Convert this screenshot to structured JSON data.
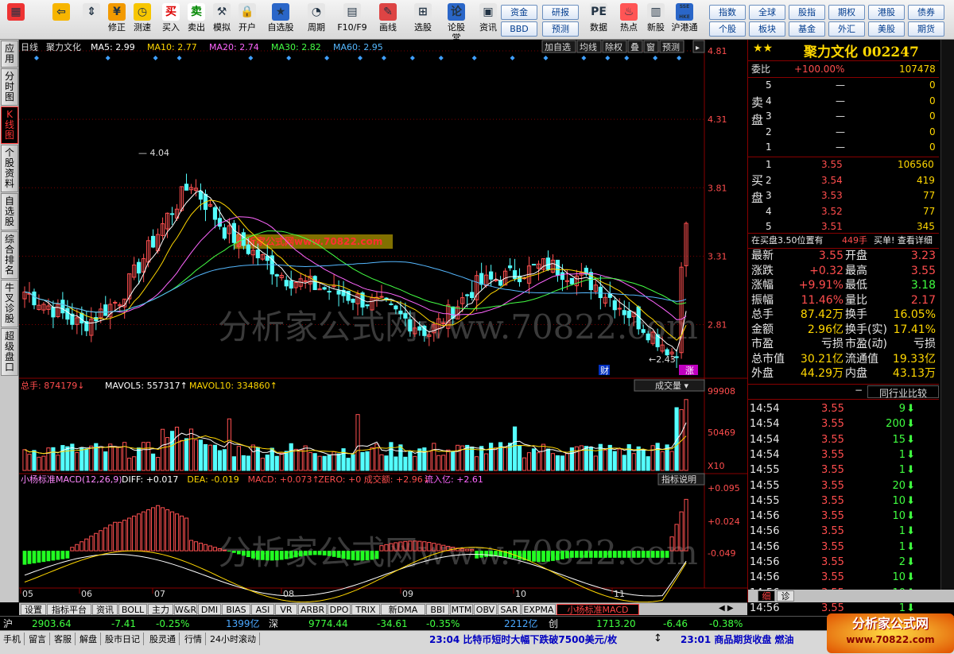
{
  "toolbar": {
    "buttons": [
      {
        "label": "",
        "icon": "grid-icon"
      },
      {
        "label": "",
        "icon": "back-arrow-icon"
      },
      {
        "label": "",
        "icon": "up-down-icon"
      },
      {
        "label": "修正",
        "icon": "money-icon"
      },
      {
        "label": "测速",
        "icon": "clock-icon"
      },
      {
        "label": "买入",
        "icon": "buy-icon"
      },
      {
        "label": "卖出",
        "icon": "sell-icon"
      },
      {
        "label": "模拟",
        "icon": "hammer-icon"
      },
      {
        "label": "开户",
        "icon": "lock-icon"
      },
      {
        "label": "自选股",
        "icon": "star-icon"
      },
      {
        "label": "周期",
        "icon": "clock-dial-icon"
      },
      {
        "label": "F10/F9",
        "icon": "info-icon"
      },
      {
        "label": "画线",
        "icon": "pencil-icon"
      },
      {
        "label": "选股",
        "icon": "filter-icon"
      },
      {
        "label": "论股堂",
        "icon": "discuss-icon"
      },
      {
        "label": "资讯",
        "icon": "news-icon"
      },
      {
        "label": "数据",
        "icon": "pe-icon"
      },
      {
        "label": "热点",
        "icon": "fire-icon"
      },
      {
        "label": "新股",
        "icon": "new-stock-icon"
      },
      {
        "label": "沪港通",
        "icon": "hk-icon"
      }
    ],
    "link_buttons": [
      "资金",
      "BBD",
      "研报",
      "预测",
      "指数",
      "个股",
      "全球",
      "板块",
      "股指",
      "基金",
      "期权",
      "外汇",
      "港股",
      "美股",
      "债券",
      "期货"
    ],
    "icon_texts": {
      "buy": "买",
      "sell": "卖",
      "discuss": "论",
      "pe": "PE",
      "hk": "SSE HKE"
    }
  },
  "sidetabs": [
    "应用",
    "分时图",
    "K线图",
    "个股资料",
    "自选股",
    "综合排名",
    "牛叉诊股",
    "超级盘口"
  ],
  "chart_header": {
    "period": "日线",
    "name": "聚力文化",
    "ma5": "MA5: 2.99",
    "ma10": "MA10: 2.77",
    "ma20": "MA20: 2.74",
    "ma30": "MA30: 2.82",
    "ma60": "MA60: 2.95"
  },
  "chart_buttons": [
    "加自选",
    "均线",
    "除权",
    "叠",
    "窗",
    "预测"
  ],
  "vol_header": {
    "total": "总手: 874179",
    "mavol5": "MAVOL5: 557317",
    "mavol10": "MAVOL10: 334860",
    "dropdown": "成交量"
  },
  "macd_header": {
    "name": "小杨标准MACD(12,26,9)",
    "diff": "DIFF: +0.017",
    "dea": "DEA: -0.019",
    "macd": "MACD: +0.073",
    "zero": "ZERO: +0",
    "amount": "成交额: +2.96",
    "inflow": "流入亿: +2.61",
    "help": "指标说明"
  },
  "watermark": {
    "main": "分析家公式网www.70822.com",
    "banner": "分析家公式网www.70822.com"
  },
  "axis_labels": {
    "price": [
      "4.81",
      "4.31",
      "3.81",
      "3.31",
      "2.81"
    ],
    "vol": [
      "99908",
      "50469",
      "X10"
    ],
    "macd": [
      "+0.095",
      "+0.024",
      "-0.049"
    ],
    "months": [
      "05",
      "06",
      "07",
      "08",
      "09",
      "10",
      "11"
    ]
  },
  "markers": {
    "hi": "4.04",
    "lo": "2.43",
    "fin": "财",
    "limit": "涨"
  },
  "chart_data": {
    "type": "candlestick",
    "price_range": [
      2.43,
      4.81
    ],
    "high": 4.04,
    "low": 2.43,
    "last_close": 3.55,
    "ma": {
      "MA5": 2.99,
      "MA10": 2.77,
      "MA20": 2.74,
      "MA30": 2.82,
      "MA60": 2.95
    },
    "volume_range": [
      0,
      99908
    ],
    "macd_range": [
      -0.049,
      0.095
    ],
    "macd": {
      "DIFF": 0.017,
      "DEA": -0.019,
      "MACD": 0.073
    }
  },
  "quote": {
    "title": "聚力文化",
    "code": "002247",
    "webi": {
      "label": "委比",
      "value": "+100.00%",
      "vol": "107478"
    },
    "sell_label": "卖盘",
    "buy_label": "买盘",
    "asks": [
      {
        "n": "5",
        "p": "—",
        "v": "0"
      },
      {
        "n": "4",
        "p": "—",
        "v": "0"
      },
      {
        "n": "3",
        "p": "—",
        "v": "0"
      },
      {
        "n": "2",
        "p": "—",
        "v": "0"
      },
      {
        "n": "1",
        "p": "—",
        "v": "0"
      }
    ],
    "bids": [
      {
        "n": "1",
        "p": "3.55",
        "v": "106560"
      },
      {
        "n": "2",
        "p": "3.54",
        "v": "419"
      },
      {
        "n": "3",
        "p": "3.53",
        "v": "77"
      },
      {
        "n": "4",
        "p": "3.52",
        "v": "77"
      },
      {
        "n": "5",
        "p": "3.51",
        "v": "345"
      }
    ],
    "note": {
      "text": "在买盘3.50位置有",
      "count": "449手",
      "action": "买单! 查看详细"
    },
    "stats": [
      {
        "k1": "最新",
        "v1": "3.55",
        "k2": "开盘",
        "v2": "3.23"
      },
      {
        "k1": "涨跌",
        "v1": "+0.32",
        "k2": "最高",
        "v2": "3.55"
      },
      {
        "k1": "涨幅",
        "v1": "+9.91%",
        "k2": "最低",
        "v2": "3.18"
      },
      {
        "k1": "振幅",
        "v1": "11.46%",
        "k2": "量比",
        "v2": "2.17"
      },
      {
        "k1": "总手",
        "v1": "87.42万",
        "k2": "换手",
        "v2": "16.05%"
      },
      {
        "k1": "金额",
        "v1": "2.96亿",
        "k2": "换手(实)",
        "v2": "17.41%"
      },
      {
        "k1": "市盈",
        "v1": "亏损",
        "k2": "市盈(动)",
        "v2": "亏损"
      },
      {
        "k1": "总市值",
        "v1": "30.21亿",
        "k2": "流通值",
        "v2": "19.33亿"
      },
      {
        "k1": "外盘",
        "v1": "44.29万",
        "k2": "内盘",
        "v2": "43.13万"
      }
    ],
    "compare": "同行业比较",
    "ticks": [
      {
        "t": "14:54",
        "p": "3.55",
        "v": "9",
        "d": "down"
      },
      {
        "t": "14:54",
        "p": "3.55",
        "v": "200",
        "d": "down"
      },
      {
        "t": "14:54",
        "p": "3.55",
        "v": "15",
        "d": "down"
      },
      {
        "t": "14:54",
        "p": "3.55",
        "v": "1",
        "d": "down"
      },
      {
        "t": "14:55",
        "p": "3.55",
        "v": "1",
        "d": "down"
      },
      {
        "t": "14:55",
        "p": "3.55",
        "v": "20",
        "d": "down"
      },
      {
        "t": "14:55",
        "p": "3.55",
        "v": "10",
        "d": "down"
      },
      {
        "t": "14:56",
        "p": "3.55",
        "v": "10",
        "d": "down"
      },
      {
        "t": "14:56",
        "p": "3.55",
        "v": "1",
        "d": "down"
      },
      {
        "t": "14:56",
        "p": "3.55",
        "v": "1",
        "d": "down"
      },
      {
        "t": "14:56",
        "p": "3.55",
        "v": "2",
        "d": "down"
      },
      {
        "t": "14:56",
        "p": "3.55",
        "v": "10",
        "d": "down"
      },
      {
        "t": "14:56",
        "p": "3.55",
        "v": "10",
        "d": "down"
      },
      {
        "t": "14:56",
        "p": "3.55",
        "v": "1",
        "d": "down"
      },
      {
        "t": "15:00",
        "p": "3.55",
        "v": "337",
        "d": "up"
      }
    ],
    "bottom_tabs": [
      "细",
      "诊"
    ]
  },
  "bottom_tabs": [
    "设置",
    "指标平台",
    "资讯",
    "BOLL",
    "主力",
    "W&R",
    "DMI",
    "BIAS",
    "ASI",
    "VR",
    "ARBR",
    "DPO",
    "TRIX",
    "新DMA",
    "BBI",
    "MTM",
    "OBV",
    "SAR",
    "EXPMA",
    "小杨标准MACD"
  ],
  "status1": {
    "sh": "沪",
    "sh_idx": "2903.64",
    "sh_chg": "-7.41",
    "sh_pct": "-0.25%",
    "sh_amt": "1399亿",
    "sz": "深",
    "sz_idx": "9774.44",
    "sz_chg": "-34.61",
    "sz_pct": "-0.35%",
    "sz_amt": "2212亿",
    "cy": "创",
    "cy_idx": "1713.20",
    "cy_chg": "-6.46",
    "cy_pct": "-0.38%"
  },
  "status2": {
    "items": [
      "手机",
      "留言",
      "客服",
      "解盘",
      "股市日记",
      "股灵通",
      "行情",
      "24小时滚动"
    ],
    "news1": "23:04 比特币短时大幅下跌破7500美元/枚",
    "news2": "23:01 商品期货收盘 燃油",
    "logo": "分析家公式网",
    "logo_url": "www.70822.com"
  }
}
